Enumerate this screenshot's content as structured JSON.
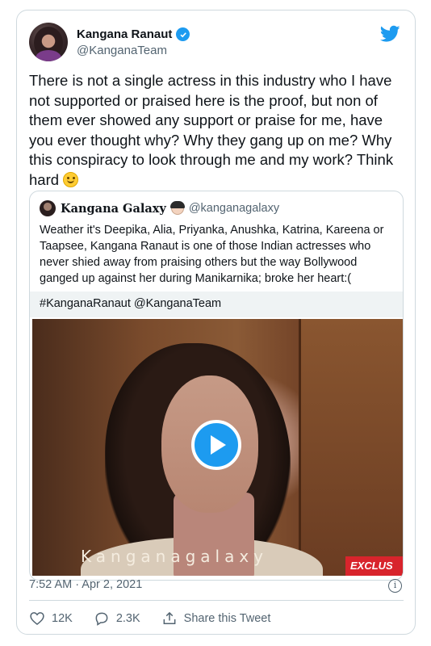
{
  "author": {
    "name": "Kangana Ranaut",
    "handle": "@KanganaTeam",
    "verified": true
  },
  "tweet": {
    "text": "There is not a single actress in this industry who I have not supported or praised here is the proof, but non of them ever showed any support or praise for me, have you ever thought why? Why they gang up on me? Why this conspiracy to look through me and my work? Think hard",
    "timestamp": "7:52 AM · Apr 2, 2021"
  },
  "quoted": {
    "name": "Kangana Galaxy",
    "handle": "@kanganagalaxy",
    "text": "Weather it's Deepika, Alia, Priyanka, Anushka, Katrina, Kareena or Taapsee, Kangana Ranaut is one of those Indian actresses who never shied away from praising others but the way Bollywood ganged up against her during Manikarnika; broke her heart:(",
    "tags": "#KanganaRanaut @KanganaTeam",
    "video_watermark": "Kanganagalaxy",
    "video_badge": "EXCLUS"
  },
  "actions": {
    "likes": "12K",
    "replies": "2.3K",
    "share_label": "Share this Tweet"
  },
  "icons": [
    "twitter-bird-icon",
    "verified-badge-icon",
    "play-icon",
    "info-icon",
    "heart-icon",
    "reply-icon",
    "share-icon"
  ],
  "colors": {
    "accent": "#1d9bf0",
    "secondary_text": "#536471",
    "border": "#cfd9de"
  }
}
